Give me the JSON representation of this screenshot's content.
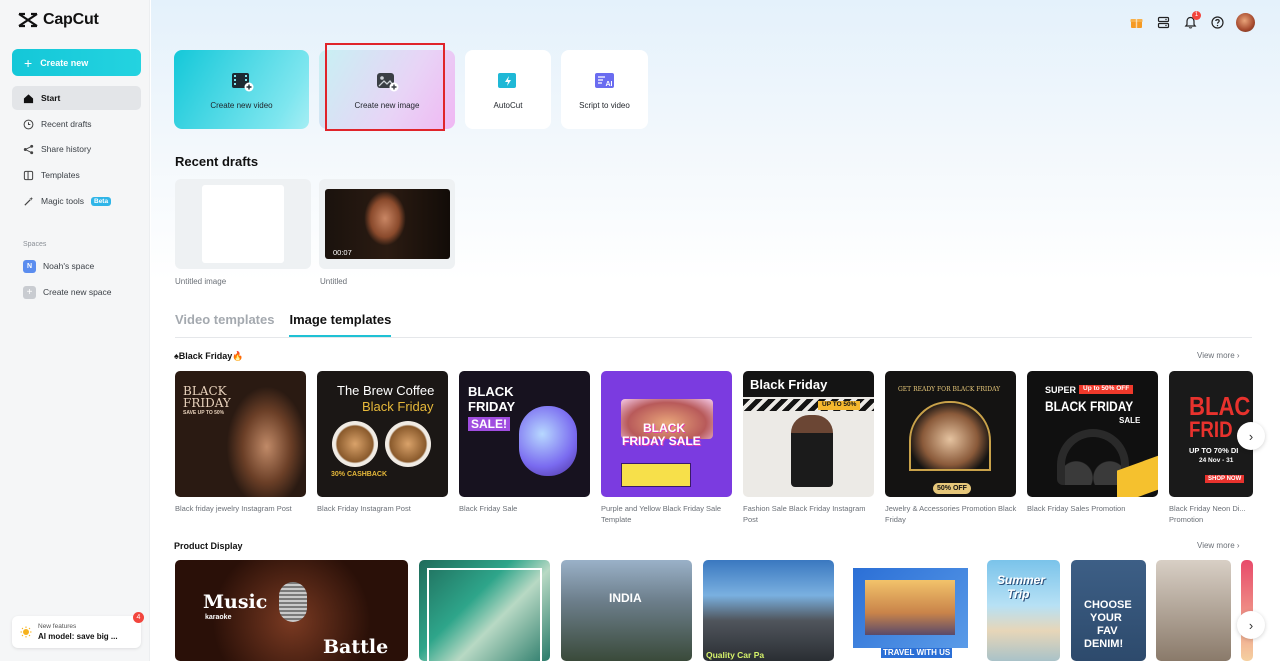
{
  "app": {
    "name": "CapCut"
  },
  "sidebar": {
    "create_label": "Create new",
    "items": [
      {
        "label": "Start",
        "icon": "home-icon"
      },
      {
        "label": "Recent drafts",
        "icon": "clock-icon"
      },
      {
        "label": "Share history",
        "icon": "share-icon"
      },
      {
        "label": "Templates",
        "icon": "templates-icon"
      },
      {
        "label": "Magic tools",
        "icon": "magic-wand-icon",
        "badge": "Beta"
      }
    ],
    "spaces_label": "Spaces",
    "spaces": [
      {
        "label": "Noah's space",
        "initial": "N"
      },
      {
        "label": "Create new space"
      }
    ],
    "new_features": {
      "title": "New features",
      "subtitle": "AI model: save big ...",
      "count": "4"
    }
  },
  "topbar": {
    "notification_count": "1"
  },
  "actions": [
    {
      "label": "Create new video"
    },
    {
      "label": "Create new image"
    },
    {
      "label": "AutoCut"
    },
    {
      "label": "Script to video"
    }
  ],
  "recent_drafts": {
    "title": "Recent drafts",
    "items": [
      {
        "label": "Untitled image"
      },
      {
        "label": "Untitled",
        "duration": "00:07"
      }
    ]
  },
  "tabs": [
    {
      "label": "Video templates",
      "active": false
    },
    {
      "label": "Image templates",
      "active": true
    }
  ],
  "black_friday": {
    "title": "♠Black Friday🔥",
    "view_more": "View more",
    "items": [
      {
        "caption": "Black friday jewelry Instagram Post",
        "t1": "BLACK",
        "t2": "FRIDAY",
        "t3": "SAVE UP TO 50%"
      },
      {
        "caption": "Black Friday Instagram Post",
        "t1": "The Brew Coffee",
        "t2": "Black Friday",
        "t3": "30% CASHBACK"
      },
      {
        "caption": "Black Friday Sale",
        "t1": "BLACK",
        "t2": "FRIDAY",
        "t3": "SALE!"
      },
      {
        "caption": "Purple and Yellow Black Friday Sale Template",
        "t1": "BLACK",
        "t2": "FRIDAY SALE"
      },
      {
        "caption": "Fashion Sale Black Friday Instagram Post",
        "t1": "Black Friday",
        "t2": "UP TO 50%"
      },
      {
        "caption": "Jewelry & Accessories Promotion Black Friday",
        "t1": "GET READY FOR BLACK FRIDAY",
        "t2": "50% OFF"
      },
      {
        "caption": "Black Friday Sales Promotion",
        "t1": "SUPER",
        "t2": "BLACK FRIDAY",
        "t3": "Up to 50% OFF",
        "t4": "SALE"
      },
      {
        "caption": "Black Friday Neon Di... Promotion",
        "t1": "BLAC",
        "t2": "FRID",
        "t3": "UP TO 70% DI",
        "t4": "24 Nov - 31",
        "t5": "SHOP NOW"
      }
    ]
  },
  "product_display": {
    "title": "Product Display",
    "view_more": "View more",
    "items": [
      {
        "t1": "Music",
        "t2": "karaoke",
        "t3": "Battle"
      },
      {
        "t1": ""
      },
      {
        "t1": "INDIA"
      },
      {
        "t1": "Quality Car Pa"
      },
      {
        "t1": "TRAVEL WITH US"
      },
      {
        "t1": "Summer",
        "t2": "Trip"
      },
      {
        "t1": "CHOOSE",
        "t2": "YOUR",
        "t3": "FAV",
        "t4": "DENIM!"
      },
      {
        "t1": ""
      }
    ]
  }
}
